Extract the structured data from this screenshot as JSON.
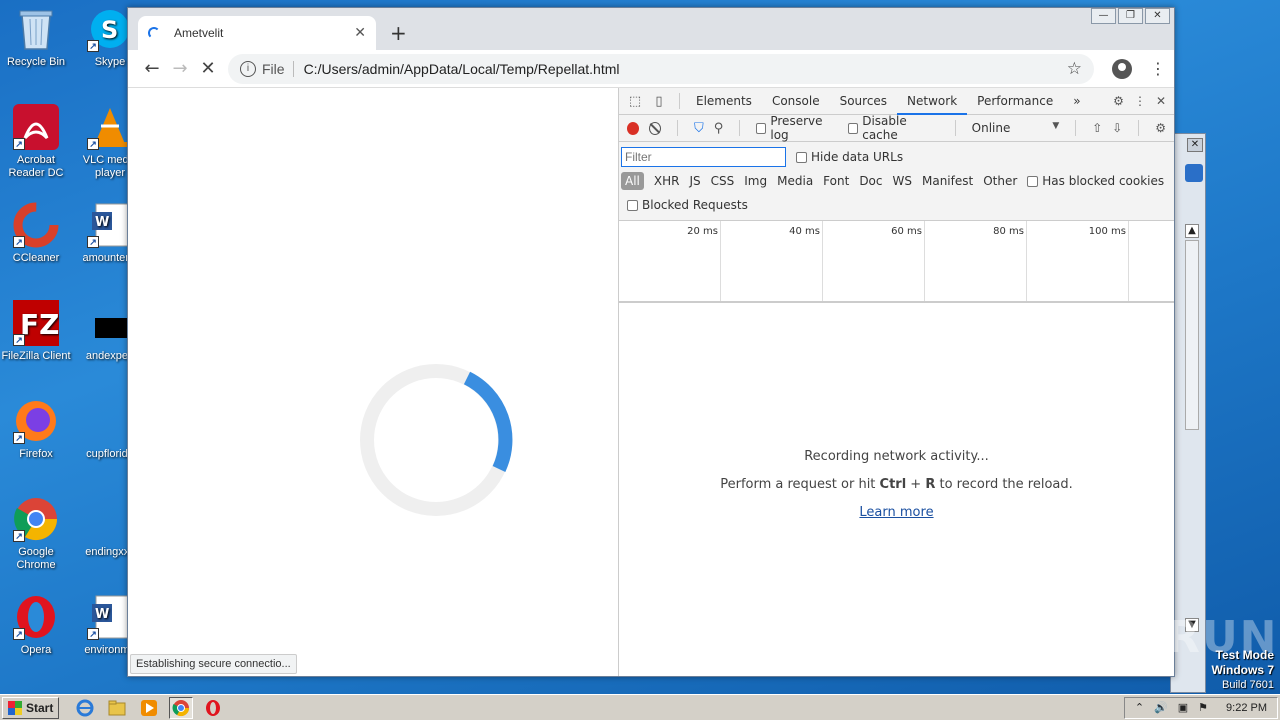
{
  "desktop": {
    "icons": [
      {
        "label": "Recycle Bin",
        "name": "recycle-bin-icon"
      },
      {
        "label": "Acrobat Reader DC",
        "name": "acrobat-reader-icon"
      },
      {
        "label": "CCleaner",
        "name": "ccleaner-icon"
      },
      {
        "label": "FileZilla Client",
        "name": "filezilla-icon"
      },
      {
        "label": "Firefox",
        "name": "firefox-icon"
      },
      {
        "label": "Google Chrome",
        "name": "google-chrome-icon"
      },
      {
        "label": "Opera",
        "name": "opera-icon"
      }
    ],
    "icons_col2": [
      {
        "label": "Skype"
      },
      {
        "label": "VLC media player"
      },
      {
        "label": "amountend"
      },
      {
        "label": "andexperi"
      },
      {
        "label": "cupflorida"
      },
      {
        "label": "endingxxx"
      },
      {
        "label": "environme"
      }
    ],
    "watermark": {
      "mode": "Test Mode",
      "os": "Windows 7",
      "build": "Build 7601",
      "brand": "ANY RUN"
    }
  },
  "browser": {
    "tab_title": "Ametvelit",
    "tab_close": "✕",
    "new_tab": "+",
    "window_buttons": {
      "minimize": "—",
      "restore": "❐",
      "close": "✕"
    },
    "nav": {
      "back": "←",
      "forward": "→",
      "stop": "✕"
    },
    "omnibox": {
      "scheme": "File",
      "url": "C:/Users/admin/AppData/Local/Temp/Repellat.html",
      "star": "☆",
      "info": "i"
    },
    "menu": "⋮",
    "status": "Establishing secure connectio..."
  },
  "devtools": {
    "tabs": [
      "Elements",
      "Console",
      "Sources",
      "Network",
      "Performance"
    ],
    "active_tab": "Network",
    "more_tabs": "»",
    "toolbar": {
      "preserve_log": "Preserve log",
      "disable_cache": "Disable cache",
      "throttle": "Online",
      "throttle_arrow": "▼"
    },
    "filter": {
      "placeholder": "Filter",
      "hide_data_urls": "Hide data URLs",
      "types": [
        "All",
        "XHR",
        "JS",
        "CSS",
        "Img",
        "Media",
        "Font",
        "Doc",
        "WS",
        "Manifest",
        "Other"
      ],
      "has_blocked_cookies": "Has blocked cookies",
      "blocked_requests": "Blocked Requests"
    },
    "timeline_ticks": [
      "20 ms",
      "40 ms",
      "60 ms",
      "80 ms",
      "100 ms"
    ],
    "empty": {
      "line1": "Recording network activity...",
      "line2_pre": "Perform a request or hit ",
      "line2_key1": "Ctrl",
      "line2_plus": " + ",
      "line2_key2": "R",
      "line2_post": " to record the reload.",
      "learn_more": "Learn more"
    }
  },
  "taskbar": {
    "start": "Start",
    "time": "9:22 PM"
  },
  "colors": {
    "accent": "#1a73e8",
    "record": "#d93025",
    "spinner": "#3a8ee0"
  }
}
